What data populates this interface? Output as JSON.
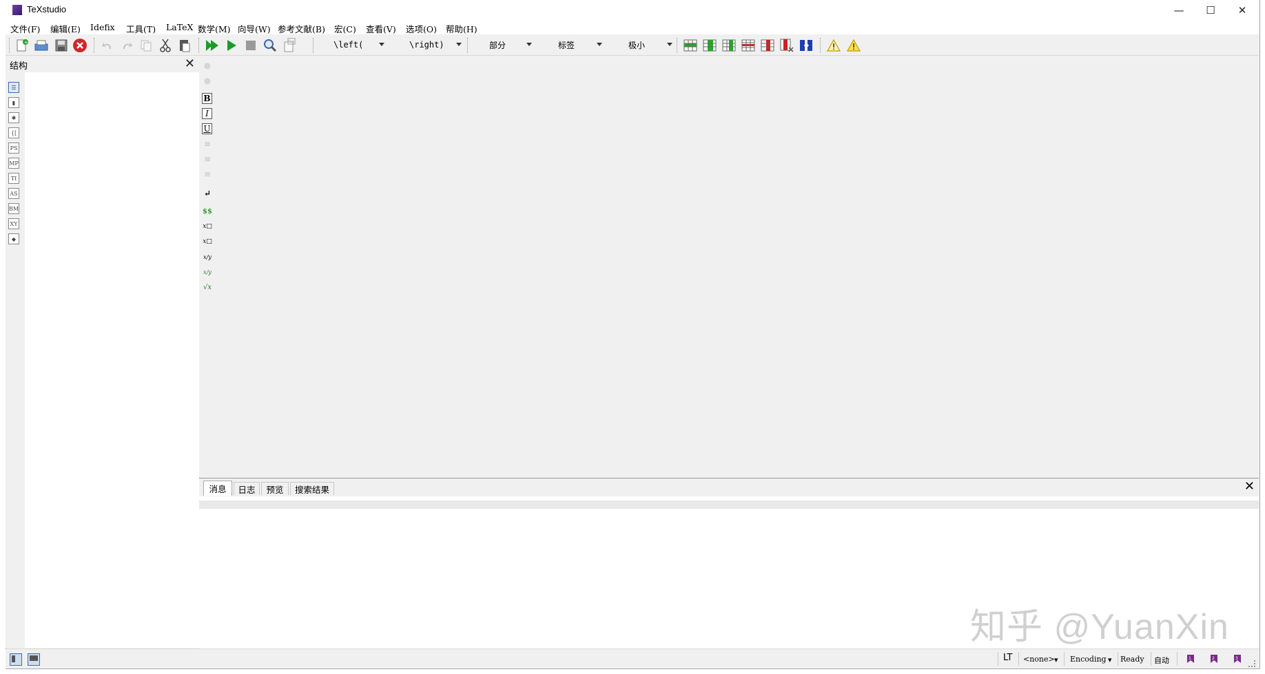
{
  "window": {
    "title": "TeXstudio",
    "minimize_glyph": "—",
    "maximize_glyph": "☐",
    "close_glyph": "✕"
  },
  "menu": [
    "文件(F)",
    "编辑(E)",
    "Idefix",
    "工具(T)",
    "LaTeX",
    "数学(M)",
    "向导(W)",
    "参考文献(B)",
    "宏(C)",
    "查看(V)",
    "选项(O)",
    "帮助(H)"
  ],
  "toolbar": {
    "left_delim": "\\left(",
    "right_delim": "\\right)",
    "section": "部分",
    "label": "标签",
    "size": "极小",
    "icons": [
      "new-file-icon",
      "print-icon",
      "save-icon",
      "close-file-icon",
      "undo-icon",
      "redo-icon",
      "copy-icon",
      "cut-icon",
      "paste-icon",
      "build-view-icon",
      "compile-icon",
      "stop-icon",
      "view-icon",
      "log-icon"
    ],
    "table_icons": [
      "add-row-icon",
      "add-column-icon",
      "insert-column-icon",
      "remove-row-icon",
      "remove-column-icon",
      "delete-cell-icon",
      "align-icon"
    ],
    "warning_icons": [
      "warning-icon",
      "warning-icon"
    ]
  },
  "structure": {
    "title": "结构",
    "close_glyph": "✕",
    "icons": [
      {
        "name": "structure-list-icon",
        "glyph": "☰"
      },
      {
        "name": "bookmark-icon",
        "glyph": "▮"
      },
      {
        "name": "asterisk-icon",
        "glyph": "✱"
      },
      {
        "name": "brackets-icon",
        "glyph": "{["
      },
      {
        "name": "ps-icon",
        "glyph": "PS"
      },
      {
        "name": "mp-icon",
        "glyph": "MP"
      },
      {
        "name": "ti-icon",
        "glyph": "TI"
      },
      {
        "name": "as-icon",
        "glyph": "AS"
      },
      {
        "name": "bm-icon",
        "glyph": "BM"
      },
      {
        "name": "xy-icon",
        "glyph": "XY"
      },
      {
        "name": "symbols-icon",
        "glyph": "◆"
      }
    ]
  },
  "side_tools": [
    {
      "name": "arrow-up-icon",
      "glyph": "●"
    },
    {
      "name": "arrow-down-icon",
      "glyph": "●"
    },
    {
      "name": "bold-icon",
      "glyph": "B"
    },
    {
      "name": "italic-icon",
      "glyph": "I"
    },
    {
      "name": "underline-icon",
      "glyph": "U"
    },
    {
      "name": "align-left-icon",
      "glyph": "≡"
    },
    {
      "name": "align-center-icon",
      "glyph": "≡"
    },
    {
      "name": "align-right-icon",
      "glyph": "≡"
    },
    {
      "name": "newline-icon",
      "glyph": "↵"
    },
    {
      "name": "math-mode-icon",
      "glyph": "$$"
    },
    {
      "name": "subscript-icon",
      "glyph": "x□"
    },
    {
      "name": "superscript-icon",
      "glyph": "x□"
    },
    {
      "name": "fraction-icon",
      "glyph": "x/y"
    },
    {
      "name": "dfrac-icon",
      "glyph": "x/y"
    },
    {
      "name": "sqrt-icon",
      "glyph": "√x"
    }
  ],
  "bottom_panel": {
    "tabs": [
      "消息",
      "日志",
      "预览",
      "搜索结果"
    ],
    "close_glyph": "✕"
  },
  "status": {
    "lt": "LT",
    "language": "<none>",
    "encoding": "Encoding",
    "state": "Ready",
    "auto": "自动"
  },
  "watermark": "知乎 @YuanXin",
  "colors": {
    "accent": "#2a9a2a",
    "close_red": "#d0262b",
    "table_green": "#22aa22",
    "table_red": "#cc2222",
    "warning_yellow": "#e8b400",
    "bookmark_purple": "#7a2a8a"
  }
}
